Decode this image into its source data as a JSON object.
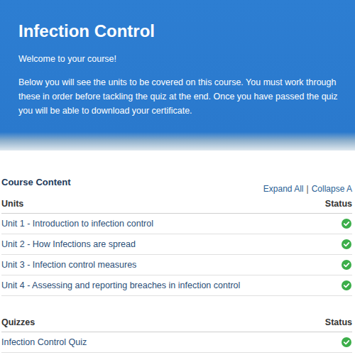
{
  "header": {
    "title": "Infection Control",
    "welcome": "Welcome to your course!",
    "intro": "Below you will see the units to be covered on this course. You must work through these in order before tackling the quiz at the end. Once you have passed the quiz you will be able to download your certificate."
  },
  "course_content": {
    "title": "Course Content",
    "expand_all": "Expand All",
    "separator": "|",
    "collapse_all": "Collapse A"
  },
  "sections": [
    {
      "heading": "Units",
      "status_heading": "Status",
      "items": [
        {
          "label": "Unit 1 - Introduction to infection control",
          "completed": true
        },
        {
          "label": "Unit 2 - How Infections are spread",
          "completed": true
        },
        {
          "label": "Unit 3 - Infection control measures",
          "completed": true
        },
        {
          "label": "Unit 4 - Assessing and reporting breaches in infection control",
          "completed": true
        }
      ]
    },
    {
      "heading": "Quizzes",
      "status_heading": "Status",
      "items": [
        {
          "label": "Infection Control Quiz",
          "completed": true
        }
      ]
    }
  ]
}
